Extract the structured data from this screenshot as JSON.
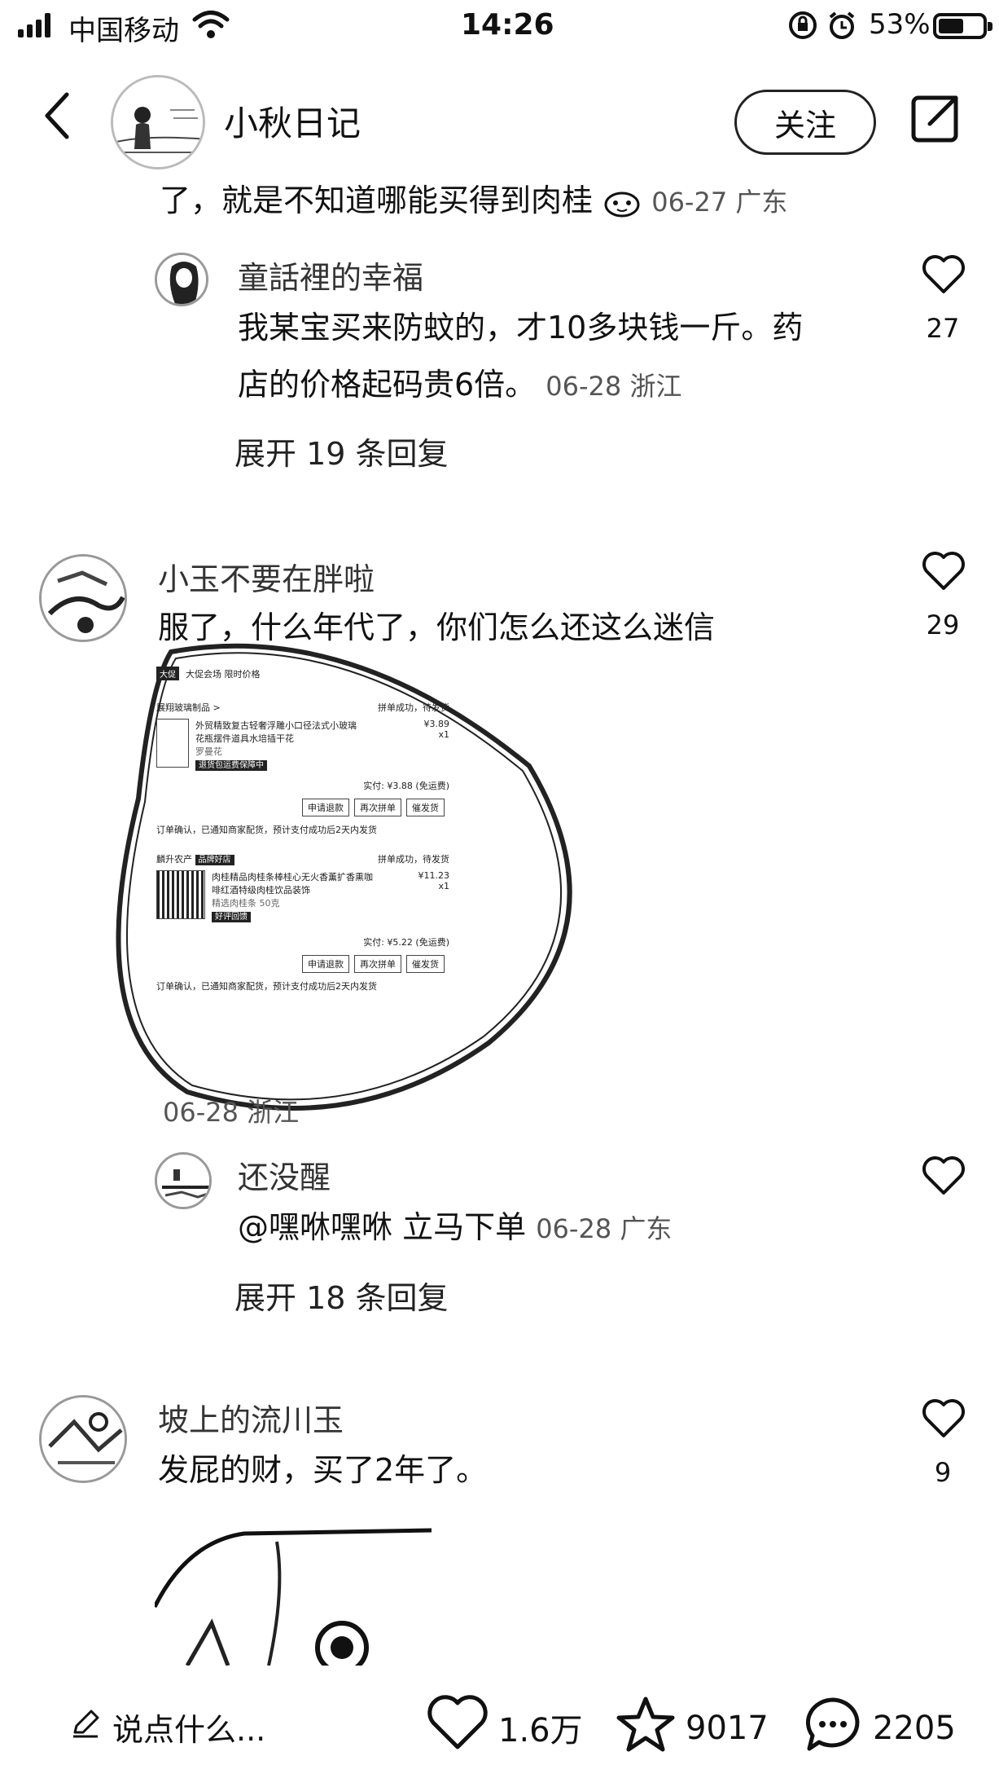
{
  "status_bar": {
    "carrier": "中国移动",
    "time": "14:26",
    "battery": "53%"
  },
  "header": {
    "author": "小秋日记",
    "follow_label": "关注"
  },
  "truncated_comment": {
    "text": "了，就是不知道哪能买得到肉桂",
    "date": "06-27 广东"
  },
  "comments": [
    {
      "name": "童話裡的幸福",
      "text_line1": "我某宝买来防蚊的，才10多块钱一斤。药",
      "text_line2": "店的价格起码贵6倍。",
      "date": "06-28 浙江",
      "likes": "27",
      "expand": "展开 19 条回复"
    },
    {
      "name": "小玉不要在胖啦",
      "text": "服了，什么年代了，你们怎么还这么迷信",
      "date": "06-28 浙江",
      "likes": "29",
      "reply": {
        "name": "还没醒",
        "text": "@嘿咻嘿咻 立马下单",
        "date": "06-28 广东"
      },
      "expand": "展开 18 条回复"
    },
    {
      "name": "坡上的流川玉",
      "text": "发屁的财，买了2年了。",
      "likes": "9"
    }
  ],
  "order_screenshot": {
    "header_left": "大促",
    "header_text": "大促会场 限时价格",
    "order1": {
      "shop": "展翔玻璃制品 >",
      "status": "拼单成功，待发货",
      "title1": "外贸精致复古轻奢浮雕小口径法式小玻璃",
      "title2": "花瓶摆件道具水培插干花",
      "spec": "罗曼花",
      "price": "¥3.89",
      "qty": "x1",
      "tag": "退货包运费保障中",
      "paid": "实付: ¥3.88 (免运费)",
      "buttons": [
        "申请退款",
        "再次拼单",
        "催发货"
      ],
      "notice": "订单确认，已通知商家配货，预计支付成功后2天内发货"
    },
    "order2": {
      "shop": "麟升农产",
      "shop_tag": "品牌好店",
      "status": "拼单成功，待发货",
      "title1": "肉桂精品肉桂条棒桂心无火香薰扩香熏咖",
      "title2": "啡红酒特级肉桂饮品装饰",
      "spec": "精选肉桂条 50克",
      "price": "¥11.23",
      "qty": "x1",
      "tag": "好评回馈",
      "paid": "实付: ¥5.22 (免运费)",
      "buttons": [
        "申请退款",
        "再次拼单",
        "催发货"
      ],
      "notice": "订单确认，已通知商家配货，预计支付成功后2天内发货"
    }
  },
  "bottom_bar": {
    "input_placeholder": "说点什么...",
    "likes": "1.6万",
    "favorites": "9017",
    "comments": "2205"
  },
  "colors": {
    "text": "#111111",
    "meta": "#555555",
    "background": "#ffffff"
  }
}
